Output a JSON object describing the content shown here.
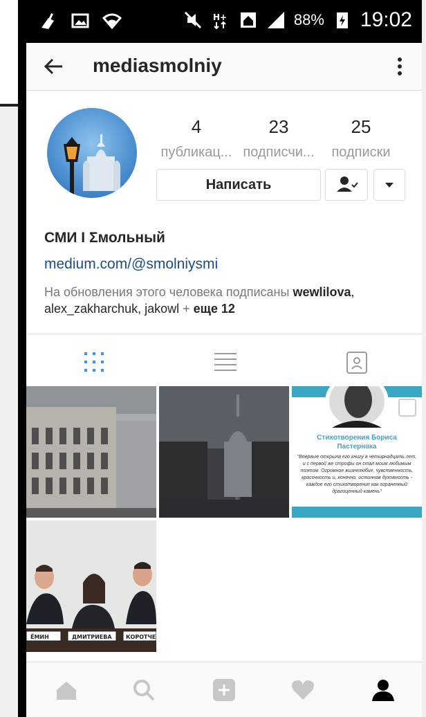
{
  "status_bar": {
    "battery_percent": "88%",
    "time": "19:02"
  },
  "app_bar": {
    "title": "mediasmolniy",
    "icons": [
      "back-arrow-icon",
      "more-vertical-icon"
    ]
  },
  "profile": {
    "stats": [
      {
        "value": "4",
        "label": "публикац..."
      },
      {
        "value": "23",
        "label": "подписчи..."
      },
      {
        "value": "25",
        "label": "подписки"
      }
    ],
    "message_button": "Написать",
    "name": "СМИ I Σмольный",
    "website": "medium.com/@smolniysmi",
    "followed_by_prefix": "На обновления этого человека подписаны ",
    "followed_by_user1": "wewlilova",
    "followed_by_rest": ", alex_zakharchuk, jakowl",
    "followed_by_plus": " + ",
    "followed_by_more": "еще 12"
  },
  "tabs": [
    "grid-icon",
    "list-icon",
    "tagged-icon"
  ],
  "posts": [
    {
      "type": "photo",
      "subject": "government-building"
    },
    {
      "type": "photo",
      "subject": "smolny-cathedral"
    },
    {
      "type": "text-card",
      "card_title": "Стихотворения Бориса Пастернака",
      "card_text": "\"Впервые открыла его книгу в четырнадцать лет, и с первой же строфы он стал моим любимым поэтом. Огромное жизнелюбие, чувственность, красочность и, конечно, истинная духовность - каждое его стихотворение как ограненный драгоценный камень\""
    },
    {
      "type": "photo",
      "subject": "three-people",
      "nameplates": [
        "ЁМИН",
        "ДМИТРИЕВА",
        "КОРОТЧЕ"
      ]
    }
  ],
  "bottom_nav": [
    "home-icon",
    "search-icon",
    "add-icon",
    "heart-icon",
    "profile-icon"
  ],
  "colors": {
    "link": "#1a4e84",
    "accent": "#3897f0",
    "card_title": "#3aa6c4"
  }
}
